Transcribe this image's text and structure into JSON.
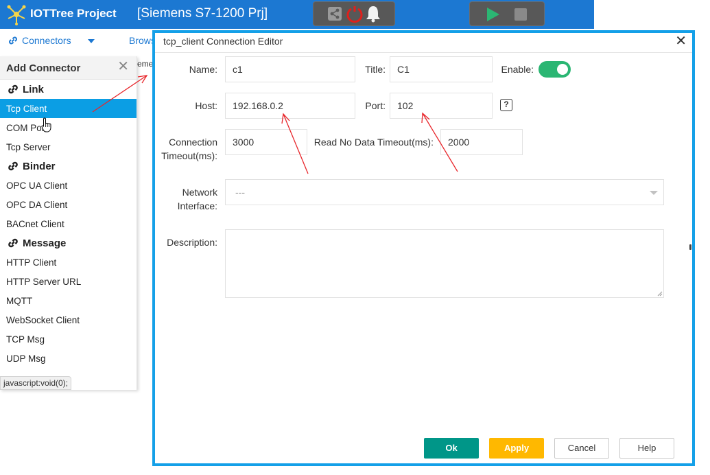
{
  "header": {
    "app_title": "IOTTree Project",
    "project_title": "[Siemens S7-1200 Prj]",
    "colors": {
      "topbar": "#1c78d2",
      "tool_group": "#585858",
      "play": "#2bb673"
    },
    "icons": [
      "share-icon",
      "power-icon",
      "bell-icon",
      "play-icon",
      "stop-icon"
    ]
  },
  "nav": {
    "connectors_label": "Connectors",
    "browse_label": "Browser",
    "crumb_peek": "eme"
  },
  "panel": {
    "title": "Add Connector",
    "sections": [
      {
        "title": "Link",
        "items": [
          {
            "label": "Tcp Client",
            "selected": true
          },
          {
            "label": "COM Port"
          },
          {
            "label": "Tcp Server"
          }
        ]
      },
      {
        "title": "Binder",
        "items": [
          {
            "label": "OPC UA Client"
          },
          {
            "label": "OPC DA Client"
          },
          {
            "label": "BACnet Client"
          }
        ]
      },
      {
        "title": "Message",
        "items": [
          {
            "label": "HTTP Client"
          },
          {
            "label": "HTTP Server URL"
          },
          {
            "label": "MQTT"
          },
          {
            "label": "WebSocket Client"
          },
          {
            "label": "TCP Msg"
          },
          {
            "label": "UDP Msg"
          }
        ]
      }
    ],
    "status_url": "javascript:void(0);"
  },
  "dialog": {
    "title": "tcp_client Connection Editor",
    "accent_color": "#14a0e8",
    "name": {
      "label": "Name:",
      "value": "c1"
    },
    "title_field": {
      "label": "Title:",
      "value": "C1"
    },
    "enable": {
      "label": "Enable:",
      "on": true
    },
    "host": {
      "label": "Host:",
      "value": "192.168.0.2"
    },
    "port": {
      "label": "Port:",
      "value": "102"
    },
    "conn_timeout": {
      "label_line1": "Connection",
      "label_line2": "Timeout(ms):",
      "value": "3000"
    },
    "read_timeout": {
      "label": "Read No Data Timeout(ms):",
      "value": "2000"
    },
    "network": {
      "label_line1": "Network",
      "label_line2": "Interface:",
      "selected": "---"
    },
    "description": {
      "label": "Description:",
      "value": ""
    },
    "buttons": {
      "ok": "Ok",
      "apply": "Apply",
      "cancel": "Cancel",
      "help": "Help"
    }
  }
}
